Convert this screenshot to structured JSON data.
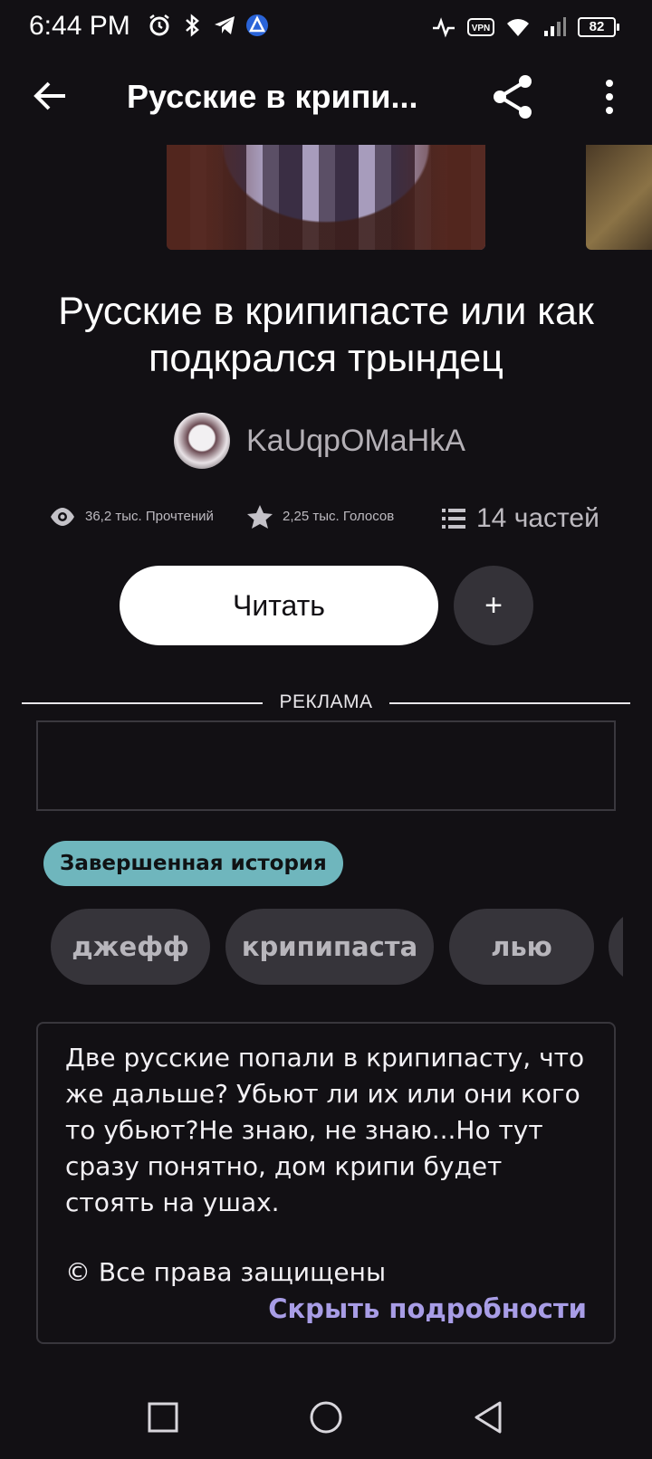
{
  "status_bar": {
    "time": "6:44 PM",
    "battery": "82",
    "vpn_label": "VPN",
    "icons": [
      "alarm-icon",
      "bluetooth-icon",
      "telegram-icon",
      "app-icon",
      "activity-icon",
      "vpn-icon",
      "wifi-icon",
      "signal-icon",
      "battery-icon"
    ]
  },
  "app_bar": {
    "title": "Русские в крипи...",
    "icons": [
      "back-arrow-icon",
      "share-icon",
      "more-vertical-icon"
    ]
  },
  "story": {
    "title": "Русские в крипипасте или как подкрался трындец",
    "author": "KaUqpOMaHkA",
    "stats": {
      "reads": "36,2 тыс. Прочтений",
      "votes": "2,25 тыс. Голосов",
      "parts": "14 частей"
    }
  },
  "actions": {
    "read_label": "Читать",
    "add_label": "+"
  },
  "ad": {
    "label": "РЕКЛАМА"
  },
  "status_badge": "Завершенная история",
  "tags": [
    "джефф",
    "крипипаста",
    "лью"
  ],
  "description": {
    "text": "Две русские попали в крипипасту, что же дальше? Убьют ли их или они кого то убьют?Не знаю, не знаю...Но тут сразу понятно, дом крипи будет стоять на ушах.",
    "copyright": "© Все права защищены",
    "hide_label": "Скрыть подробности"
  },
  "nav": {
    "icons": [
      "recents-square-icon",
      "home-circle-icon",
      "back-triangle-icon"
    ]
  },
  "colors": {
    "background": "#121014",
    "badge": "#6fb6bd",
    "link": "#a89de6",
    "chip": "#36343a"
  }
}
